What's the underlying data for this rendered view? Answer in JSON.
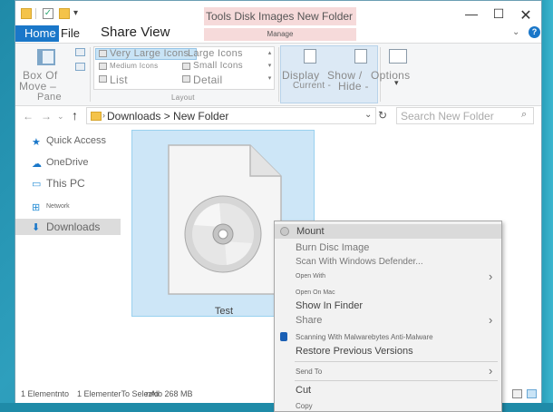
{
  "titlebar": {
    "tools_tab": "Tools Disk Images New Folder",
    "minimize": "—",
    "maximize": "☐",
    "close": "✕"
  },
  "ribbon_tabs": {
    "home": "Home",
    "file": "File",
    "share_view": "Share View",
    "manage": "Manage"
  },
  "ribbon": {
    "pane_label_1": "Box Of",
    "pane_label_2": "Move –",
    "pane_group": "Pane",
    "layout_items": {
      "very_large": "Very Large Icons",
      "large": "Large Icons",
      "medium": "Medium Icons",
      "small": "Small Icons",
      "list": "List",
      "detail": "Detail"
    },
    "layout_group": "Layout",
    "display_label": "Display",
    "display_sub": "Current -",
    "showhide_label": "Show /",
    "showhide_sub": "Hide -",
    "options_label": "Options"
  },
  "address": {
    "path": "Downloads > New Folder",
    "search_placeholder": "Search New Folder"
  },
  "nav": {
    "items": [
      {
        "label": "Quick Access",
        "icon": "star-icon"
      },
      {
        "label": "OneDrive",
        "icon": "cloud-icon"
      },
      {
        "label": "This PC",
        "icon": "computer-icon"
      },
      {
        "label": "Network",
        "icon": "network-icon"
      },
      {
        "label": "Downloads",
        "icon": "download-arrow-icon"
      }
    ]
  },
  "content": {
    "file_name": "Test"
  },
  "statusbar": {
    "count": "1 Elementnto",
    "selection": "1 ElementerTo Selezio",
    "size": "nAlb 268 MB"
  },
  "context_menu": {
    "items": [
      {
        "label": "Mount"
      },
      {
        "label": "Burn Disc Image"
      },
      {
        "label": "Scan With Windows Defender..."
      },
      {
        "label": "Open With"
      },
      {
        "label": "Open On Mac"
      },
      {
        "label": "Show In Finder"
      },
      {
        "label": "Share"
      },
      {
        "label": "Scanning With Malwarebytes Anti-Malware"
      },
      {
        "label": "Restore Previous Versions"
      },
      {
        "label": "Send To"
      },
      {
        "label": "Cut"
      },
      {
        "label": "Copy"
      }
    ]
  },
  "colors": {
    "accent": "#1a77c9",
    "selection": "#cde6f7",
    "contextual_tab": "#f6dada",
    "desktop": "#1f8aa8"
  }
}
